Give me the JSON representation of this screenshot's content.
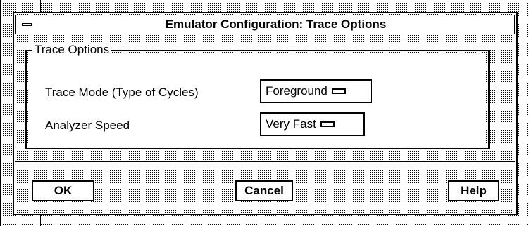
{
  "window": {
    "title": "Emulator Configuration: Trace Options",
    "menu_icon": "window-menu-icon"
  },
  "trace_options": {
    "group_title": "Trace Options",
    "trace_mode": {
      "label": "Trace Mode (Type of Cycles)",
      "value": "Foreground"
    },
    "analyzer_speed": {
      "label": "Analyzer Speed",
      "value": "Very Fast"
    }
  },
  "buttons": {
    "ok": "OK",
    "cancel": "Cancel",
    "help": "Help"
  },
  "colors": {
    "foreground": "#000000",
    "background": "#ffffff"
  }
}
